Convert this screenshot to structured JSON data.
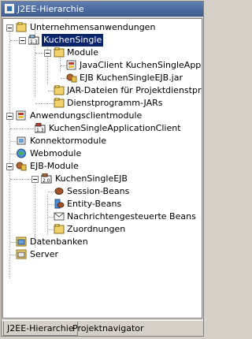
{
  "window": {
    "title": "J2EE-Hierarchie"
  },
  "tree": {
    "root": "Unternehmensanwendungen",
    "app": "KuchenSingle",
    "module_folder": "Module",
    "client_jar": "JavaClient KuchenSingleApplicatio",
    "ejb_jar": "EJB KuchenSingleEJB.jar",
    "jar_files": "JAR-Dateien für Projektdienstprogran",
    "utility_jars": "Dienstprogramm-JARs",
    "app_client_modules": "Anwendungsclientmodule",
    "app_client": "KuchenSingleApplicationClient",
    "connector_modules": "Konnektormodule",
    "web_modules": "Webmodule",
    "ejb_modules": "EJB-Module",
    "ejb_project": "KuchenSingleEJB",
    "session_beans": "Session-Beans",
    "entity_beans": "Entity-Beans",
    "message_beans": "Nachrichtengesteuerte Beans",
    "assignments": "Zuordnungen",
    "databases": "Datenbanken",
    "server": "Server",
    "version_13": "1.3",
    "version_20": "2.0"
  },
  "tabs": {
    "hierarchy": "J2EE-Hierarchie",
    "navigator": "Projektnavigator"
  },
  "colors": {
    "selection": "#0a246a",
    "folder": "#f2d36b",
    "titlebar": "#3e5a8c"
  }
}
